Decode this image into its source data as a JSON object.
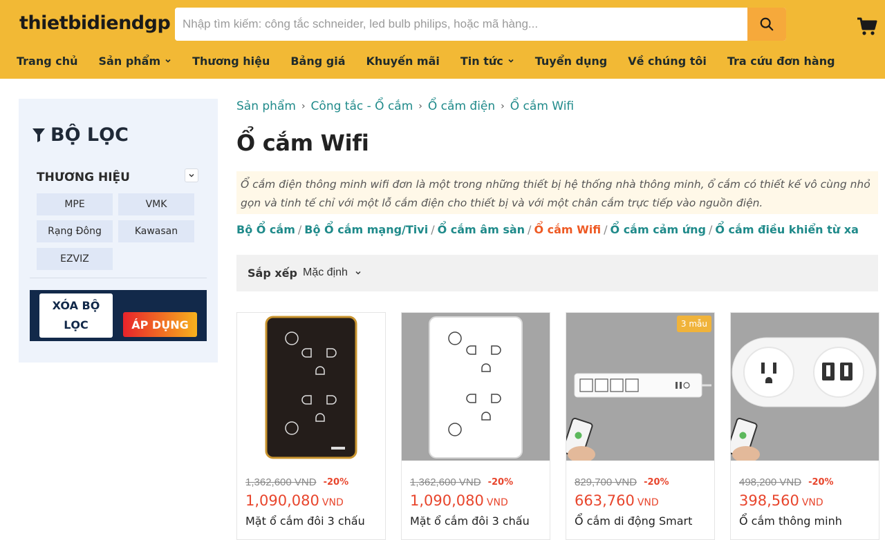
{
  "header": {
    "logo": "thietbidiendgp",
    "search_placeholder": "Nhập tìm kiếm: công tắc schneider, led bulb philips, hoặc mã hàng...",
    "nav": [
      {
        "label": "Trang chủ",
        "dropdown": false
      },
      {
        "label": "Sản phẩm",
        "dropdown": true
      },
      {
        "label": "Thương hiệu",
        "dropdown": false
      },
      {
        "label": "Bảng giá",
        "dropdown": false
      },
      {
        "label": "Khuyến mãi",
        "dropdown": false
      },
      {
        "label": "Tin tức",
        "dropdown": true
      },
      {
        "label": "Tuyển dụng",
        "dropdown": false
      },
      {
        "label": "Về chúng tôi",
        "dropdown": false
      },
      {
        "label": "Tra cứu đơn hàng",
        "dropdown": false
      }
    ],
    "icons": {
      "search": "search-icon",
      "cart": "cart-icon",
      "chevron": "chevron-down-icon"
    },
    "colors": {
      "bar": "#f2b935",
      "search_button": "#f6a93b"
    }
  },
  "sidebar": {
    "title": "BỘ LỌC",
    "brand_heading": "THƯƠNG HIỆU",
    "brands": [
      "MPE",
      "VMK",
      "Rạng Đông",
      "Kawasan",
      "EZVIZ"
    ],
    "clear_label": "XÓA BỘ LỌC",
    "apply_label": "ÁP DỤNG",
    "icons": {
      "filter": "filter-icon",
      "toggle": "chevron-down-icon"
    }
  },
  "main": {
    "breadcrumb": [
      "Sản phẩm",
      "Công tắc - Ổ cắm",
      "Ổ cắm điện",
      "Ổ cắm Wifi"
    ],
    "title": "Ổ cắm Wifi",
    "description": "Ổ cắm điện thông minh wifi đơn là một trong những thiết bị hệ thống nhà thông minh, ổ cắm có thiết kế vô cùng nhỏ gọn và tinh tế chỉ với một lỗ cắm điện cho thiết bị và với một chân cắm trực tiếp vào nguồn điện.",
    "sub_categories": [
      "Bộ Ổ cắm",
      "Bộ Ổ cắm mạng/Tivi",
      "Ổ cắm âm sàn",
      "Ổ cắm Wifi",
      "Ổ cắm cảm ứng",
      "Ổ cắm điều khiển từ xa"
    ],
    "active_sub_category": "Ổ cắm Wifi",
    "sort_label": "Sắp xếp",
    "sort_value": "Mặc định",
    "accent_color": "#1f8a8a",
    "price_color": "#e8452c"
  },
  "products": [
    {
      "old_price": "1,362,600 VND",
      "discount": "-20%",
      "price": "1,090,080",
      "currency": "VND",
      "name": "Mặt ổ cắm đôi 3 chấu",
      "badge": "",
      "image": "black-double-socket-plate"
    },
    {
      "old_price": "1,362,600 VND",
      "discount": "-20%",
      "price": "1,090,080",
      "currency": "VND",
      "name": "Mặt ổ cắm đôi 3 chấu",
      "badge": "",
      "image": "white-double-socket-plate"
    },
    {
      "old_price": "829,700 VND",
      "discount": "-20%",
      "price": "663,760",
      "currency": "VND",
      "name": "Ổ cắm di động Smart",
      "badge": "3 mẫu",
      "image": "smart-power-strip"
    },
    {
      "old_price": "498,200 VND",
      "discount": "-20%",
      "price": "398,560",
      "currency": "VND",
      "name": "Ổ cắm thông minh",
      "badge": "",
      "image": "smart-outlet-usb"
    }
  ]
}
